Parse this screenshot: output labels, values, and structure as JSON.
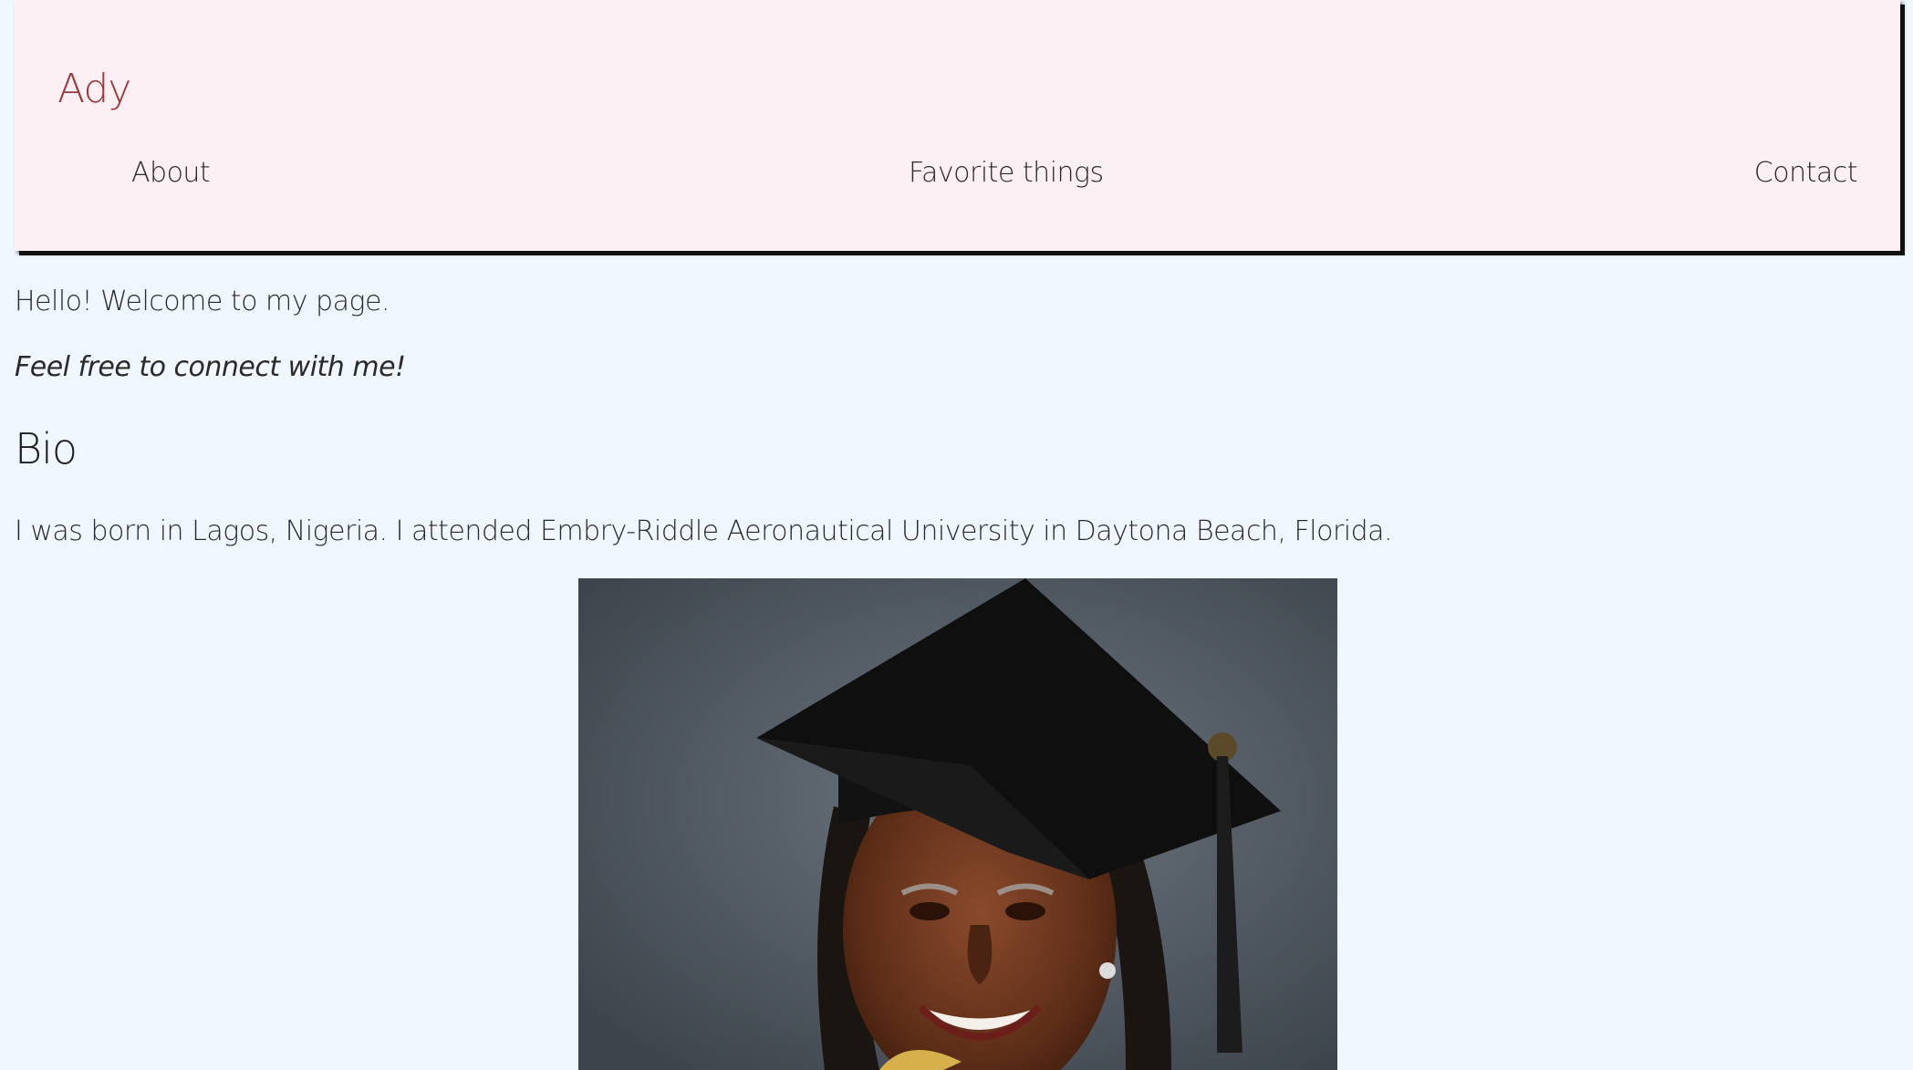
{
  "header": {
    "brand": "Ady",
    "nav": {
      "about": "About",
      "favorites": "Favorite things",
      "contact": "Contact"
    }
  },
  "main": {
    "greeting": "Hello! Welcome to my page.",
    "tagline": "Feel free to connect with me!",
    "bio_heading": "Bio",
    "bio_text": "I was born in Lagos, Nigeria. I attended Embry-Riddle Aeronautical University in Daytona Beach, Florida."
  },
  "colors": {
    "page_background": "#f1f7ff",
    "header_background": "#fcf0f4",
    "brand": "#9b3a3f",
    "text": "#2a2a2a"
  }
}
